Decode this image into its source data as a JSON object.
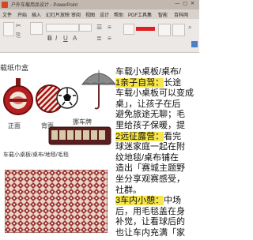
{
  "window": {
    "title": "户外车载用品设计 - PowerPoint"
  },
  "tabs": [
    "文件",
    "开始",
    "插入",
    "幻灯片放映",
    "审阅",
    "视图",
    "设计",
    "帮助",
    "PDF工具集",
    "智能",
    "百科网"
  ],
  "canvas": {
    "left_heading": "载纸巾盒",
    "labels": {
      "front": "正面",
      "back": "背面",
      "parking_sign": "挪车牌",
      "mat": "车载小桌板/桌布/地毯/毛毯"
    },
    "right_paragraphs": [
      {
        "text": "车载小桌板/桌布/",
        "highlight": false
      },
      {
        "text": "1亲子自驾：",
        "highlight": true,
        "rest": "长途"
      },
      {
        "text": "车载小桌板可以变成",
        "highlight": false
      },
      {
        "text": "桌」，让孩子在后",
        "highlight": false
      },
      {
        "text": "避免旅途无聊；毛",
        "highlight": false
      },
      {
        "text": "里给孩子保暖，提",
        "highlight": false
      },
      {
        "text": "2远征露营：",
        "highlight": true,
        "rest": "看完"
      },
      {
        "text": "球迷家庭一起在附",
        "highlight": false
      },
      {
        "text": "纹地毯/桌布铺在",
        "highlight": false
      },
      {
        "text": "造出「赛城主题野",
        "highlight": false
      },
      {
        "text": "坐分享观赛感受，",
        "highlight": false
      },
      {
        "text": "社群。",
        "highlight": false
      },
      {
        "text": "3车内小憩：",
        "highlight": true,
        "rest": "中场"
      },
      {
        "text": "后，用毛毯盖在身",
        "highlight": false
      },
      {
        "text": "补觉，让看球后的",
        "highlight": false
      },
      {
        "text": "也让车内充满「家",
        "highlight": false
      }
    ]
  },
  "colors": {
    "accent_red": "#e02020",
    "highlight": "#f6e64a",
    "plaque": "#5a1e1e"
  }
}
